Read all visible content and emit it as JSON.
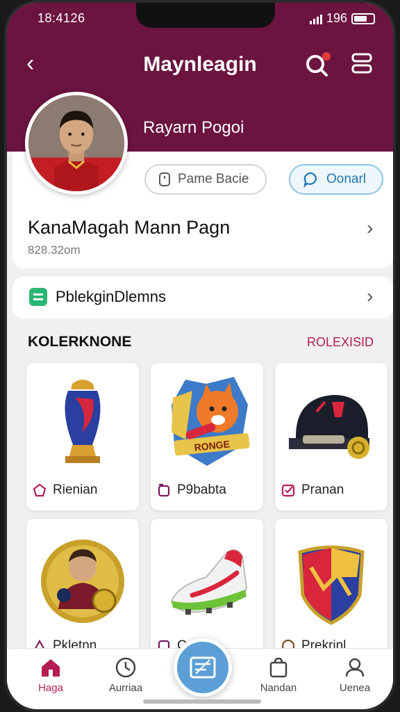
{
  "status": {
    "time": "18:4126",
    "battery": "196"
  },
  "header": {
    "title": "Maynleagin",
    "username": "Rayarn Pogoi"
  },
  "profile": {
    "pill_one_label": "Pame Bacie",
    "pill_two_label": "Oonarl",
    "name_line": "KanaMagah Mann Pagn",
    "sub_line": "828.32om"
  },
  "row2": {
    "label": "PblekginDlemns"
  },
  "collection": {
    "title": "KOLERKNONE",
    "link": "ROLEXISID",
    "items": [
      {
        "label": "Rienian",
        "icon": "trophy-icon"
      },
      {
        "label": "P9babta",
        "icon": "mascot-badge-icon"
      },
      {
        "label": "Pranan",
        "icon": "helmet-icon"
      },
      {
        "label": "Pkletnn",
        "icon": "coin-icon"
      },
      {
        "label": "C",
        "icon": "cleat-icon"
      },
      {
        "label": "Prekrinl",
        "icon": "shield-crest-icon"
      }
    ],
    "badge_text": "RONGE"
  },
  "nav": {
    "items": [
      {
        "label": "Haga",
        "icon": "home-icon"
      },
      {
        "label": "Aurriaa",
        "icon": "clock-icon"
      },
      {
        "label": "Nandan",
        "icon": "bag-icon"
      },
      {
        "label": "Uenea",
        "icon": "profile-icon"
      }
    ]
  },
  "colors": {
    "header": "#6b1440",
    "accent": "#b21e53",
    "fab": "#5b9fd6"
  }
}
